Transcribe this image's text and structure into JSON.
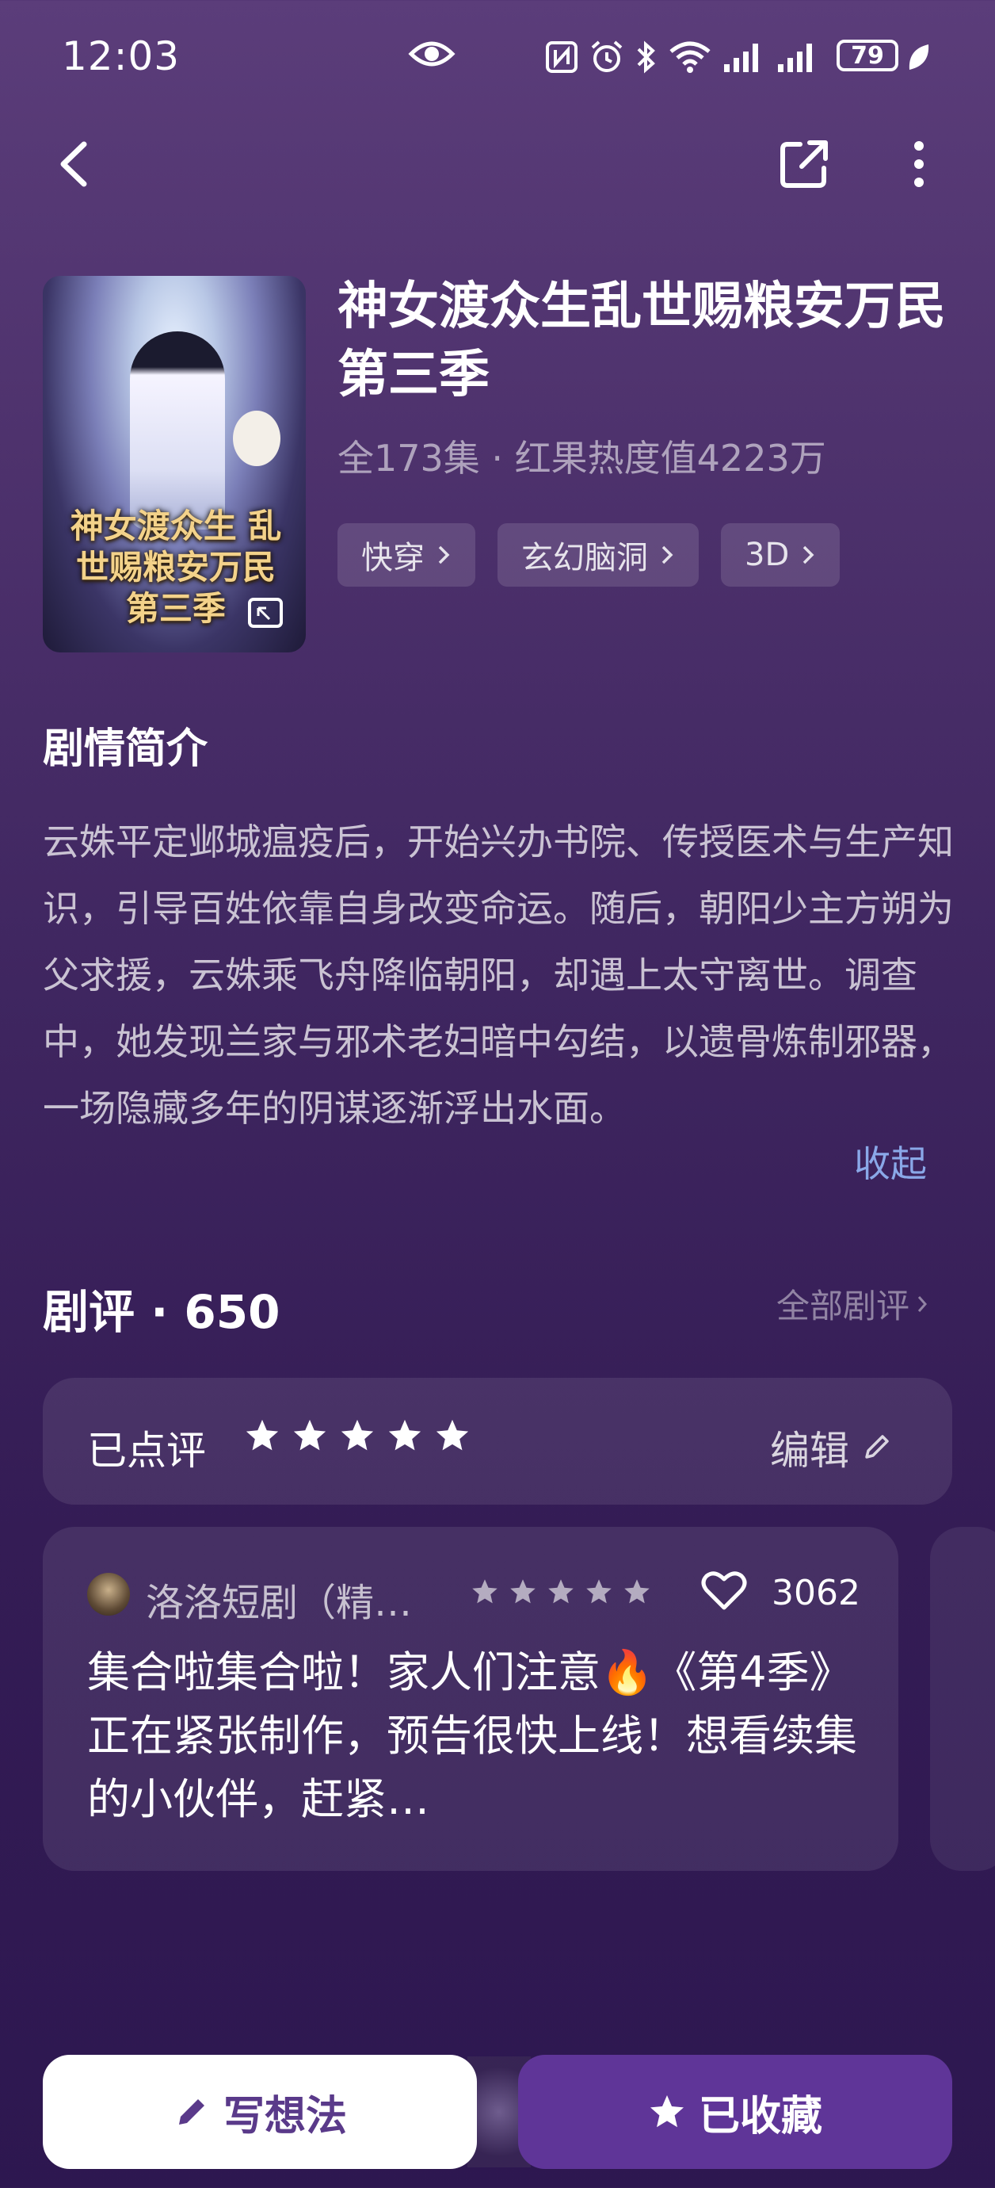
{
  "status_bar": {
    "time": "12:03",
    "battery": "79",
    "icons": [
      "eye-icon",
      "nfc-icon",
      "alarm-icon",
      "bluetooth-icon",
      "wifi-icon",
      "signal-icon",
      "signal-icon"
    ]
  },
  "nav": {
    "back_icon": "back-arrow-icon",
    "share_icon": "share-icon",
    "more_icon": "more-vertical-icon"
  },
  "drama": {
    "cover_art_text": "神女渡众生 乱世赐粮安万民 第三季",
    "title": "神女渡众生乱世赐粮安万民第三季",
    "meta": "全173集 · 红果热度值4223万",
    "tags": [
      "快穿",
      "玄幻脑洞",
      "3D"
    ]
  },
  "synopsis": {
    "heading": "剧情简介",
    "text": "云姝平定邺城瘟疫后，开始兴办书院、传授医术与生产知识，引导百姓依靠自身改变命运。随后，朝阳少主方朔为父求援，云姝乘飞舟降临朝阳，却遇上太守离世。调查中，她发现兰家与邪术老妇暗中勾结，以遗骨炼制邪器，一场隐藏多年的阴谋逐渐浮出水面。",
    "collapse_label": "收起"
  },
  "reviews": {
    "heading": "剧评 · 650",
    "all_label": "全部剧评",
    "rated_label": "已点评",
    "my_rating": 5,
    "edit_label": "编辑",
    "items": [
      {
        "user": "洛洛短剧（精…",
        "rating": 5,
        "likes": "3062",
        "text": "集合啦集合啦！家人们注意🔥《第4季》正在紧张制作，预告很快上线！想看续集的小伙伴，赶紧…"
      }
    ]
  },
  "actions": {
    "write_label": "写想法",
    "fav_label": "已收藏"
  },
  "colors": {
    "accent_purple": "#5f3598",
    "link_blue": "#8aa8e8",
    "background_top": "#5b3d7a",
    "background_bottom": "#2d1750"
  }
}
